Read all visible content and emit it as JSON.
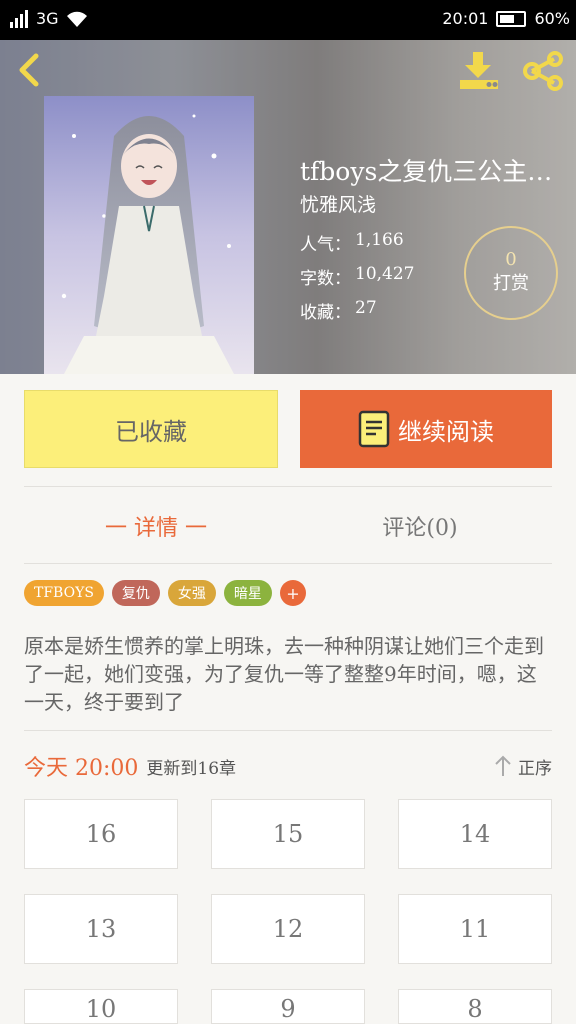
{
  "status_bar": {
    "signal": "3G",
    "time": "20:01",
    "battery": "60%"
  },
  "colors": {
    "accent": "#e9693a",
    "favorite_bg": "#fcef7a",
    "tip_ring": "#e6cf8e"
  },
  "header": {
    "icons": [
      "back-icon",
      "download-icon",
      "share-icon"
    ]
  },
  "book": {
    "title": "tfboys之复仇三公主…",
    "author": "忧雅风浅",
    "popularity_label": "人气：",
    "popularity": "1,166",
    "words_label": "字数：",
    "words": "10,427",
    "favorites_label": "收藏：",
    "favorites": "27"
  },
  "tip": {
    "count": "0",
    "label": "打赏"
  },
  "actions": {
    "favorite_label": "已收藏",
    "read_label": "继续阅读"
  },
  "tabs": {
    "detail": "一 详情 一",
    "comments": "评论(0)"
  },
  "tags": [
    {
      "label": "TFBOYS",
      "color": "#f0a431"
    },
    {
      "label": "复仇",
      "color": "#c0675a"
    },
    {
      "label": "女强",
      "color": "#d9a63a"
    },
    {
      "label": "暗星",
      "color": "#8cb33e"
    },
    {
      "label": "+",
      "color": "#e9693a"
    }
  ],
  "description": "原本是娇生惯养的掌上明珠，去一种种阴谋让她们三个走到了一起，她们变强，为了复仇一等了整整9年时间，嗯，这一天，终于要到了",
  "updates": {
    "today": "今天 20:00",
    "update_text": "更新到16章",
    "sort_label": "正序"
  },
  "chapters": [
    "16",
    "15",
    "14",
    "13",
    "12",
    "11",
    "10",
    "9",
    "8"
  ]
}
